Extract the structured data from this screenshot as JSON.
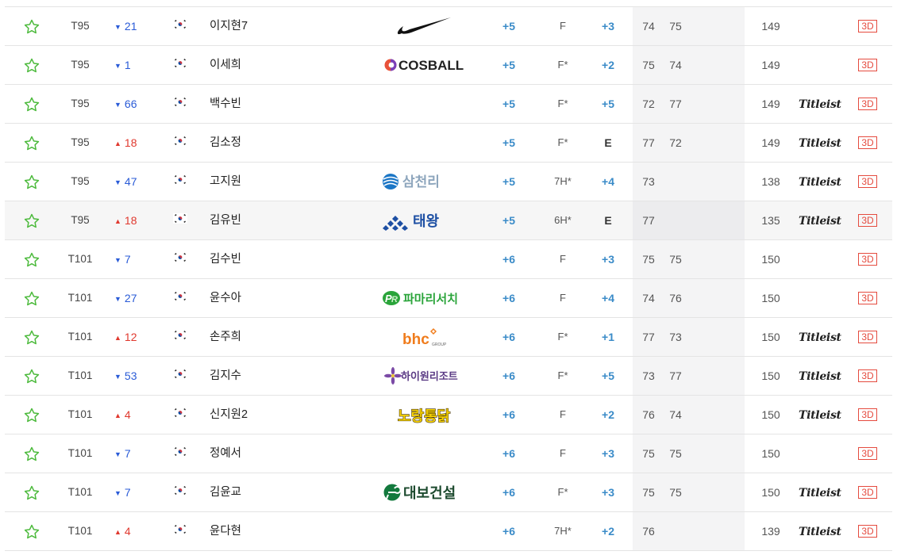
{
  "leaderboard": {
    "rows": [
      {
        "rank": "T95",
        "move_dir": "down",
        "move": "21",
        "flag": "KR",
        "name": "이지현7",
        "sponsor": "nike",
        "total": "+5",
        "thru": "F",
        "today": "+3",
        "r1": "74",
        "r2": "75",
        "strokes": "149",
        "ball": "",
        "btn": "3D"
      },
      {
        "rank": "T95",
        "move_dir": "down",
        "move": "1",
        "flag": "KR",
        "name": "이세희",
        "sponsor": "cosball",
        "total": "+5",
        "thru": "F*",
        "today": "+2",
        "r1": "75",
        "r2": "74",
        "strokes": "149",
        "ball": "",
        "btn": "3D"
      },
      {
        "rank": "T95",
        "move_dir": "down",
        "move": "66",
        "flag": "KR",
        "name": "백수빈",
        "sponsor": "",
        "total": "+5",
        "thru": "F*",
        "today": "+5",
        "r1": "72",
        "r2": "77",
        "strokes": "149",
        "ball": "Titleist",
        "btn": "3D"
      },
      {
        "rank": "T95",
        "move_dir": "up",
        "move": "18",
        "flag": "KR",
        "name": "김소정",
        "sponsor": "",
        "total": "+5",
        "thru": "F*",
        "today": "E",
        "r1": "77",
        "r2": "72",
        "strokes": "149",
        "ball": "Titleist",
        "btn": "3D"
      },
      {
        "rank": "T95",
        "move_dir": "down",
        "move": "47",
        "flag": "KR",
        "name": "고지원",
        "sponsor": "samchully",
        "total": "+5",
        "thru": "7H*",
        "today": "+4",
        "r1": "73",
        "r2": "",
        "strokes": "138",
        "ball": "Titleist",
        "btn": "3D"
      },
      {
        "rank": "T95",
        "move_dir": "up",
        "move": "18",
        "flag": "KR",
        "name": "김유빈",
        "sponsor": "taeyoung",
        "total": "+5",
        "thru": "6H*",
        "today": "E",
        "r1": "77",
        "r2": "",
        "strokes": "135",
        "ball": "Titleist",
        "btn": "3D",
        "highlight": true
      },
      {
        "rank": "T101",
        "move_dir": "down",
        "move": "7",
        "flag": "KR",
        "name": "김수빈",
        "sponsor": "",
        "total": "+6",
        "thru": "F",
        "today": "+3",
        "r1": "75",
        "r2": "75",
        "strokes": "150",
        "ball": "",
        "btn": "3D"
      },
      {
        "rank": "T101",
        "move_dir": "down",
        "move": "27",
        "flag": "KR",
        "name": "윤수아",
        "sponsor": "pamarisearch",
        "total": "+6",
        "thru": "F",
        "today": "+4",
        "r1": "74",
        "r2": "76",
        "strokes": "150",
        "ball": "",
        "btn": "3D"
      },
      {
        "rank": "T101",
        "move_dir": "up",
        "move": "12",
        "flag": "KR",
        "name": "손주희",
        "sponsor": "bhc",
        "total": "+6",
        "thru": "F*",
        "today": "+1",
        "r1": "77",
        "r2": "73",
        "strokes": "150",
        "ball": "Titleist",
        "btn": "3D"
      },
      {
        "rank": "T101",
        "move_dir": "down",
        "move": "53",
        "flag": "KR",
        "name": "김지수",
        "sponsor": "high1",
        "total": "+6",
        "thru": "F*",
        "today": "+5",
        "r1": "73",
        "r2": "77",
        "strokes": "150",
        "ball": "Titleist",
        "btn": "3D"
      },
      {
        "rank": "T101",
        "move_dir": "up",
        "move": "4",
        "flag": "KR",
        "name": "신지원2",
        "sponsor": "nojang",
        "total": "+6",
        "thru": "F",
        "today": "+2",
        "r1": "76",
        "r2": "74",
        "strokes": "150",
        "ball": "Titleist",
        "btn": "3D"
      },
      {
        "rank": "T101",
        "move_dir": "down",
        "move": "7",
        "flag": "KR",
        "name": "정예서",
        "sponsor": "",
        "total": "+6",
        "thru": "F",
        "today": "+3",
        "r1": "75",
        "r2": "75",
        "strokes": "150",
        "ball": "",
        "btn": "3D"
      },
      {
        "rank": "T101",
        "move_dir": "down",
        "move": "7",
        "flag": "KR",
        "name": "김윤교",
        "sponsor": "daebo",
        "total": "+6",
        "thru": "F*",
        "today": "+3",
        "r1": "75",
        "r2": "75",
        "strokes": "150",
        "ball": "Titleist",
        "btn": "3D"
      },
      {
        "rank": "T101",
        "move_dir": "up",
        "move": "4",
        "flag": "KR",
        "name": "윤다현",
        "sponsor": "",
        "total": "+6",
        "thru": "7H*",
        "today": "+2",
        "r1": "76",
        "r2": "",
        "strokes": "139",
        "ball": "Titleist",
        "btn": "3D"
      }
    ]
  },
  "sponsor_text": {
    "cosball": "COSBALL",
    "samchully": "삼천리",
    "taeyoung": "태왕",
    "pamarisearch": "파마리서치",
    "bhc": "bhc",
    "bhc_sub": "GROUP",
    "high1": "하이원리조트",
    "nojang": "노랑통닭",
    "daebo": "대보건설"
  },
  "colors": {
    "accent_blue": "#3a8bc8",
    "down": "#2a5bd7",
    "up": "#e0382e",
    "star": "#4cba3c",
    "btn3d": "#e54b3f"
  },
  "icons": {
    "favorite": "star-outline-icon",
    "flag": "korea-flag-icon",
    "move_up": "triangle-up-icon",
    "move_down": "triangle-down-icon"
  }
}
